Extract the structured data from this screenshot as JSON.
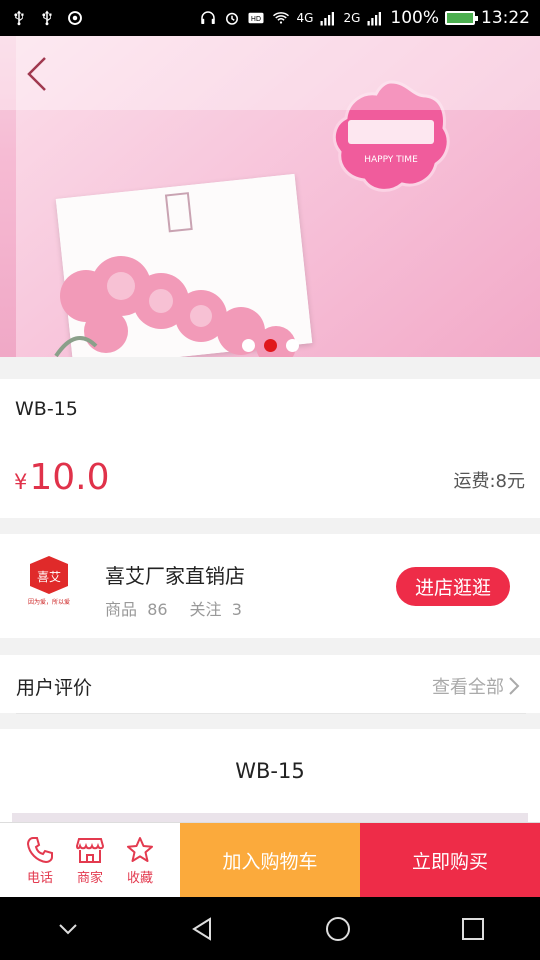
{
  "status_bar": {
    "network_4g": "4G",
    "network_2g": "2G",
    "battery": "100%",
    "time": "13:22"
  },
  "product": {
    "name": "WB-15",
    "currency": "¥",
    "price": "10.0",
    "shipping": "运费:8元"
  },
  "carousel": {
    "total": 3,
    "active": 2
  },
  "store": {
    "logo_text": "喜艾",
    "logo_sub": "因为爱，所以爱",
    "name": "喜艾厂家直销店",
    "goods_label": "商品",
    "goods_count": "86",
    "follow_label": "关注",
    "follow_count": "3",
    "enter_button": "进店逛逛"
  },
  "reviews": {
    "title": "用户评价",
    "view_all": "查看全部"
  },
  "detail": {
    "title": "WB-15"
  },
  "bottom_bar": {
    "phone": "电话",
    "merchant": "商家",
    "favorite": "收藏",
    "add_to_cart": "加入购物车",
    "buy_now": "立即购买"
  },
  "colors": {
    "accent_red": "#ee2c48",
    "cart_orange": "#fbaa3c",
    "price_red": "#e0324a"
  }
}
